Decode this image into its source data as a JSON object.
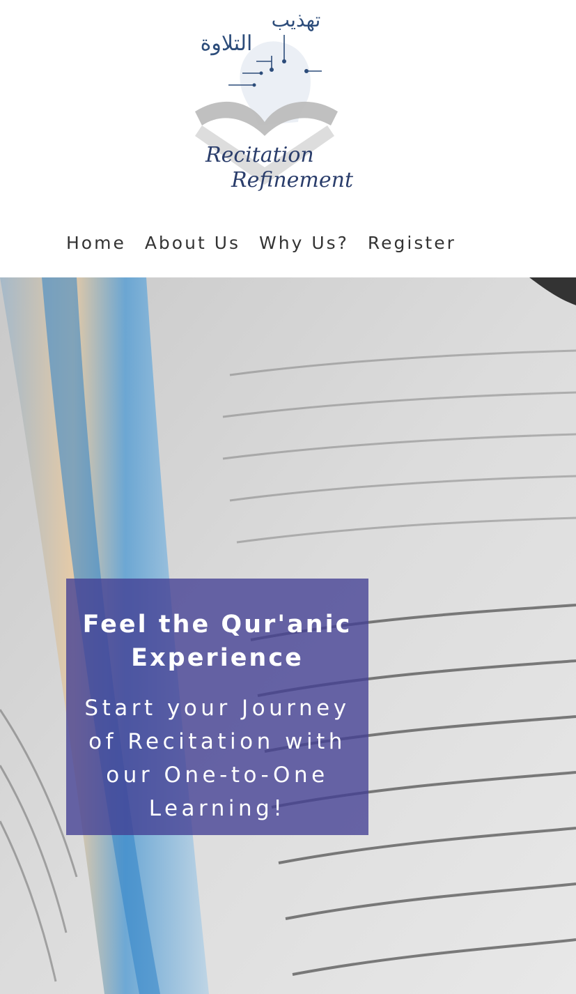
{
  "logo": {
    "arabic_line1": "تهذيب",
    "arabic_line2": "التلاوة",
    "english_line1": "Recitation",
    "english_line2": "Refinement"
  },
  "nav": {
    "items": [
      {
        "label": "Home"
      },
      {
        "label": "About Us"
      },
      {
        "label": "Why Us?"
      },
      {
        "label": "Register"
      }
    ]
  },
  "hero": {
    "title": "Feel the Qur'anic Experience",
    "subtitle": "Start your Journey of Recitation with our One-to-One Learning!",
    "panel_color": "#423f94"
  }
}
